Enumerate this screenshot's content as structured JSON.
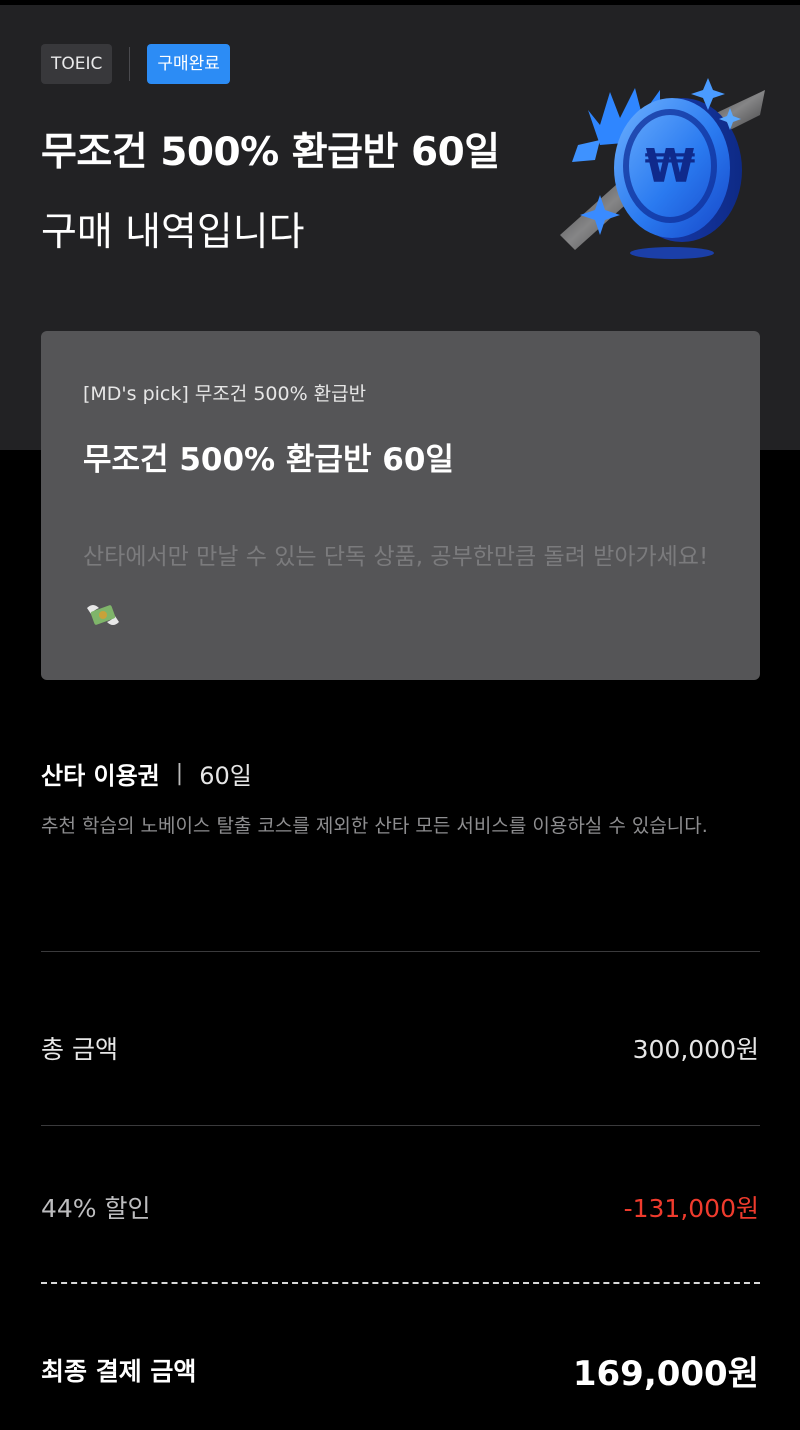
{
  "header": {
    "subject_chip": "TOEIC",
    "status_chip": "구매완료",
    "title": "무조건 500% 환급반 60일",
    "subtitle": "구매 내역입니다"
  },
  "product_card": {
    "eyebrow": "[MD's pick] 무조건 500% 환급반",
    "title": "무조건 500% 환급반 60일",
    "description": "산타에서만 만날 수 있는 단독 상품, 공부한만큼 돌려 받아가세요!"
  },
  "plan": {
    "name": "산타 이용권",
    "separator": "|",
    "duration": "60일",
    "description": "추천 학습의 노베이스 탈출 코스를 제외한 산타 모든 서비스를 이용하실 수 있습니다."
  },
  "price": {
    "total_label": "총 금액",
    "total_value": "300,000원",
    "discount_label": "44% 할인",
    "discount_value": "-131,000원",
    "final_label": "최종 결제 금액",
    "final_value": "169,000원"
  },
  "colors": {
    "accent_blue": "#2c8cf5",
    "discount_red": "#ef3b2d",
    "hero_bg": "#222224",
    "card_bg": "#555557"
  },
  "icons": {
    "hero_art": "won-coin-icon",
    "description_emoji": "money-with-wings-icon"
  }
}
